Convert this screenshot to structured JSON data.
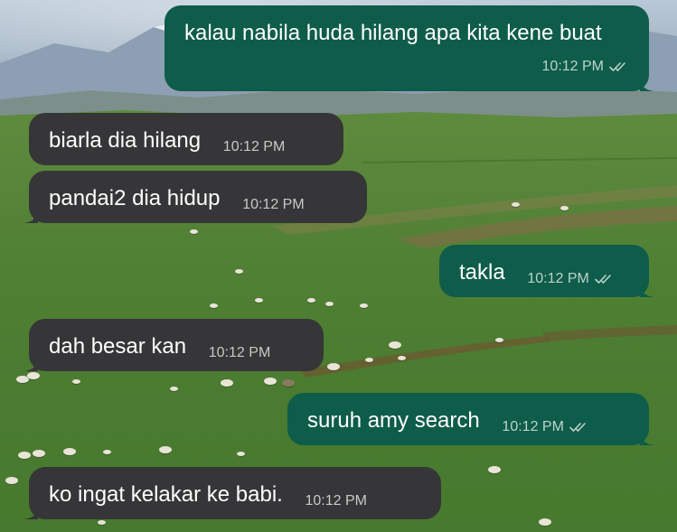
{
  "messages": [
    {
      "direction": "out",
      "text": "kalau nabila huda hilang apa kita kene buat",
      "time": "10:12 PM",
      "status_icon": "double-check-icon"
    },
    {
      "direction": "in",
      "text": "biarla dia hilang",
      "time": "10:12 PM"
    },
    {
      "direction": "in",
      "text": "pandai2 dia hidup",
      "time": "10:12 PM"
    },
    {
      "direction": "out",
      "text": "takla",
      "time": "10:12 PM",
      "status_icon": "double-check-icon"
    },
    {
      "direction": "in",
      "text": "dah besar kan",
      "time": "10:12 PM"
    },
    {
      "direction": "out",
      "text": "suruh amy search",
      "time": "10:12 PM",
      "status_icon": "double-check-icon"
    },
    {
      "direction": "in",
      "text": "ko ingat kelakar ke babi.",
      "time": "10:12 PM"
    }
  ],
  "colors": {
    "incoming_bubble": "#363638",
    "outgoing_bubble": "#0e5c4a",
    "text": "#ffffff",
    "meta_text": "#b8b8b8"
  }
}
